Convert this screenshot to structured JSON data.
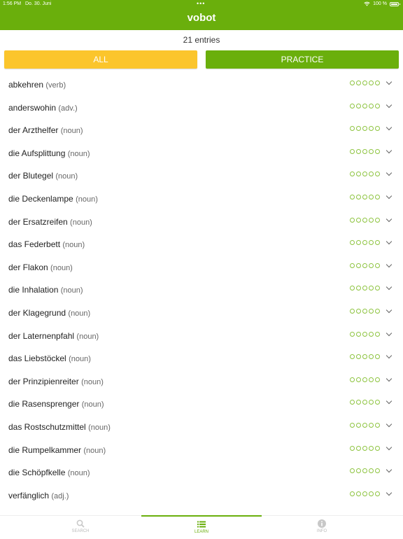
{
  "status_bar": {
    "time": "1:56 PM",
    "date": "Do. 30. Juni",
    "battery": "100 %",
    "dots": "•••"
  },
  "header": {
    "title": "vobot"
  },
  "entries_count": "21 entries",
  "buttons": {
    "all": "ALL",
    "practice": "PRACTICE"
  },
  "colors": {
    "green": "#6aaf0c",
    "yellow": "#fbc52c",
    "circle": "#8dc43f"
  },
  "entries": [
    {
      "word": "abkehren",
      "pos": "(verb)",
      "progress": 0
    },
    {
      "word": "anderswohin",
      "pos": "(adv.)",
      "progress": 0
    },
    {
      "word": "der Arzthelfer",
      "pos": "(noun)",
      "progress": 0
    },
    {
      "word": "die Aufsplittung",
      "pos": "(noun)",
      "progress": 0
    },
    {
      "word": "der Blutegel",
      "pos": "(noun)",
      "progress": 0
    },
    {
      "word": "die Deckenlampe",
      "pos": "(noun)",
      "progress": 0
    },
    {
      "word": "der Ersatzreifen",
      "pos": "(noun)",
      "progress": 0
    },
    {
      "word": "das Federbett",
      "pos": "(noun)",
      "progress": 0
    },
    {
      "word": "der Flakon",
      "pos": "(noun)",
      "progress": 0
    },
    {
      "word": "die Inhalation",
      "pos": "(noun)",
      "progress": 0
    },
    {
      "word": "der Klagegrund",
      "pos": "(noun)",
      "progress": 0
    },
    {
      "word": "der Laternenpfahl",
      "pos": "(noun)",
      "progress": 0
    },
    {
      "word": "das Liebstöckel",
      "pos": "(noun)",
      "progress": 0
    },
    {
      "word": "der Prinzipienreiter",
      "pos": "(noun)",
      "progress": 0
    },
    {
      "word": "die Rasensprenger",
      "pos": "(noun)",
      "progress": 0
    },
    {
      "word": "das Rostschutzmittel",
      "pos": "(noun)",
      "progress": 0
    },
    {
      "word": "die Rumpelkammer",
      "pos": "(noun)",
      "progress": 0
    },
    {
      "word": "die Schöpfkelle",
      "pos": "(noun)",
      "progress": 0
    },
    {
      "word": "verfänglich",
      "pos": "(adj.)",
      "progress": 0
    }
  ],
  "tabs": [
    {
      "label": "SEARCH",
      "icon": "search-icon",
      "active": false
    },
    {
      "label": "LEARN",
      "icon": "list-icon",
      "active": true
    },
    {
      "label": "INFO",
      "icon": "info-icon",
      "active": false
    }
  ]
}
